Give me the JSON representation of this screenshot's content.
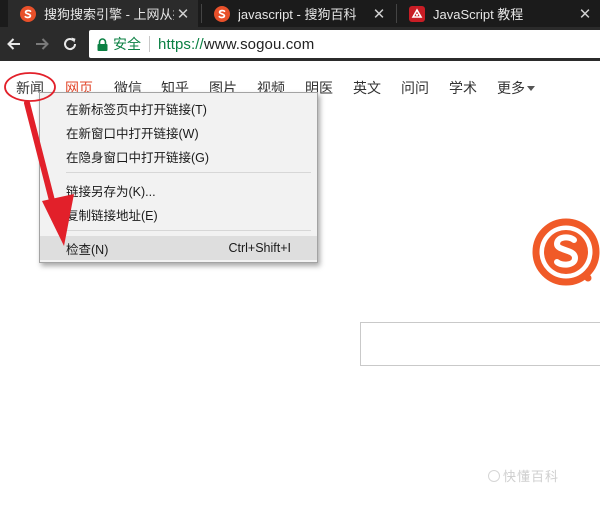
{
  "tabs": [
    {
      "title": "搜狗搜索引擎 - 上网从搜",
      "icon": "sogou-favicon",
      "active": true
    },
    {
      "title": "javascript - 搜狗百科",
      "icon": "sogou-favicon",
      "active": false
    },
    {
      "title": "JavaScript 教程",
      "icon": "runoob-favicon",
      "active": false
    }
  ],
  "tab_close_glyph": "✕",
  "toolbar": {
    "secure_label": "安全",
    "url_scheme": "https://",
    "url_host": "www.sogou.com"
  },
  "nav": {
    "items": [
      "新闻",
      "网页",
      "微信",
      "知乎",
      "图片",
      "视频",
      "明医",
      "英文",
      "问问",
      "学术",
      "更多"
    ],
    "current": "网页"
  },
  "context_menu": {
    "items": [
      {
        "label": "在新标签页中打开链接(T)",
        "shortcut": ""
      },
      {
        "label": "在新窗口中打开链接(W)",
        "shortcut": ""
      },
      {
        "label": "在隐身窗口中打开链接(G)",
        "shortcut": ""
      },
      {
        "label": "链接另存为(K)...",
        "shortcut": ""
      },
      {
        "label": "复制链接地址(E)",
        "shortcut": ""
      },
      {
        "label": "检查(N)",
        "shortcut": "Ctrl+Shift+I"
      }
    ],
    "highlighted": "检查(N)"
  },
  "watermark": "快懂百科",
  "colors": {
    "accent": "#e2482c",
    "annotation_red": "#e2202a",
    "secure_green": "#0b8043",
    "logo_orange": "#f05a28"
  }
}
